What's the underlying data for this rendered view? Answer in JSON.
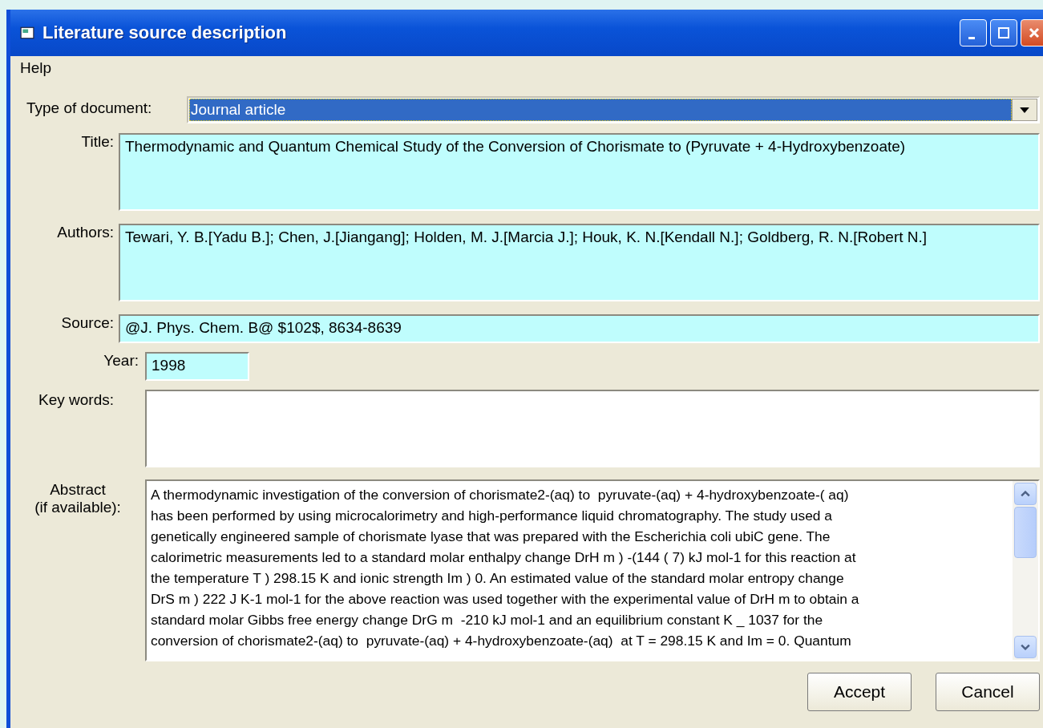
{
  "window": {
    "title": "Literature source description"
  },
  "menu": [
    "Help"
  ],
  "document_type": {
    "label": "Type of document:",
    "value": "Journal article",
    "focused": true
  },
  "fields": [
    {
      "kind": "multiline",
      "label": "Title:",
      "value": "Thermodynamic and Quantum Chemical Study of the Conversion of Chorismate to  (Pyruvate + 4-Hydroxybenzoate)"
    },
    {
      "kind": "multiline",
      "label": "Authors:",
      "value": "Tewari, Y. B.[Yadu B.]; Chen, J.[Jiangang]; Holden, M. J.[Marcia J.]; Houk, K. N.[Kendall N.]; Goldberg, R. N.[Robert N.]"
    },
    {
      "kind": "line",
      "label": "Source:",
      "value": "@J. Phys. Chem. B@ $102$, 8634-8639"
    },
    {
      "kind": "short",
      "label": "Year:",
      "value": "1998"
    },
    {
      "kind": "keywords",
      "label": "Key words:"
    }
  ],
  "abstract": {
    "label": [
      "Abstract",
      "(if available):"
    ],
    "lines": [
      "A thermodynamic investigation of the conversion of chorismate2-(aq) to  pyruvate-(aq) + 4-hydroxybenzoate-( aq)",
      "has been performed by using microcalorimetry and high-performance liquid chromatography. The study used a",
      "genetically engineered sample of chorismate lyase that was prepared with the Escherichia coli ubiC gene. The",
      "calorimetric measurements led to a standard molar enthalpy change DrH m ) -(144 ( 7) kJ mol-1 for this reaction at",
      "the temperature T ) 298.15 K and ionic strength Im ) 0. An estimated value of the standard molar entropy change",
      "DrS m ) 222 J K-1 mol-1 for the above reaction was used together with the experimental value of DrH m to obtain a",
      "standard molar Gibbs free energy change DrG m  -210 kJ mol-1 and an equilibrium constant K _ 1037 for the",
      "conversion of chorismate2-(aq) to  pyruvate-(aq) + 4-hydroxybenzoate-(aq)  at T = 298.15 K and Im = 0. Quantum"
    ]
  },
  "buttons": [
    "Accept",
    "Cancel"
  ]
}
